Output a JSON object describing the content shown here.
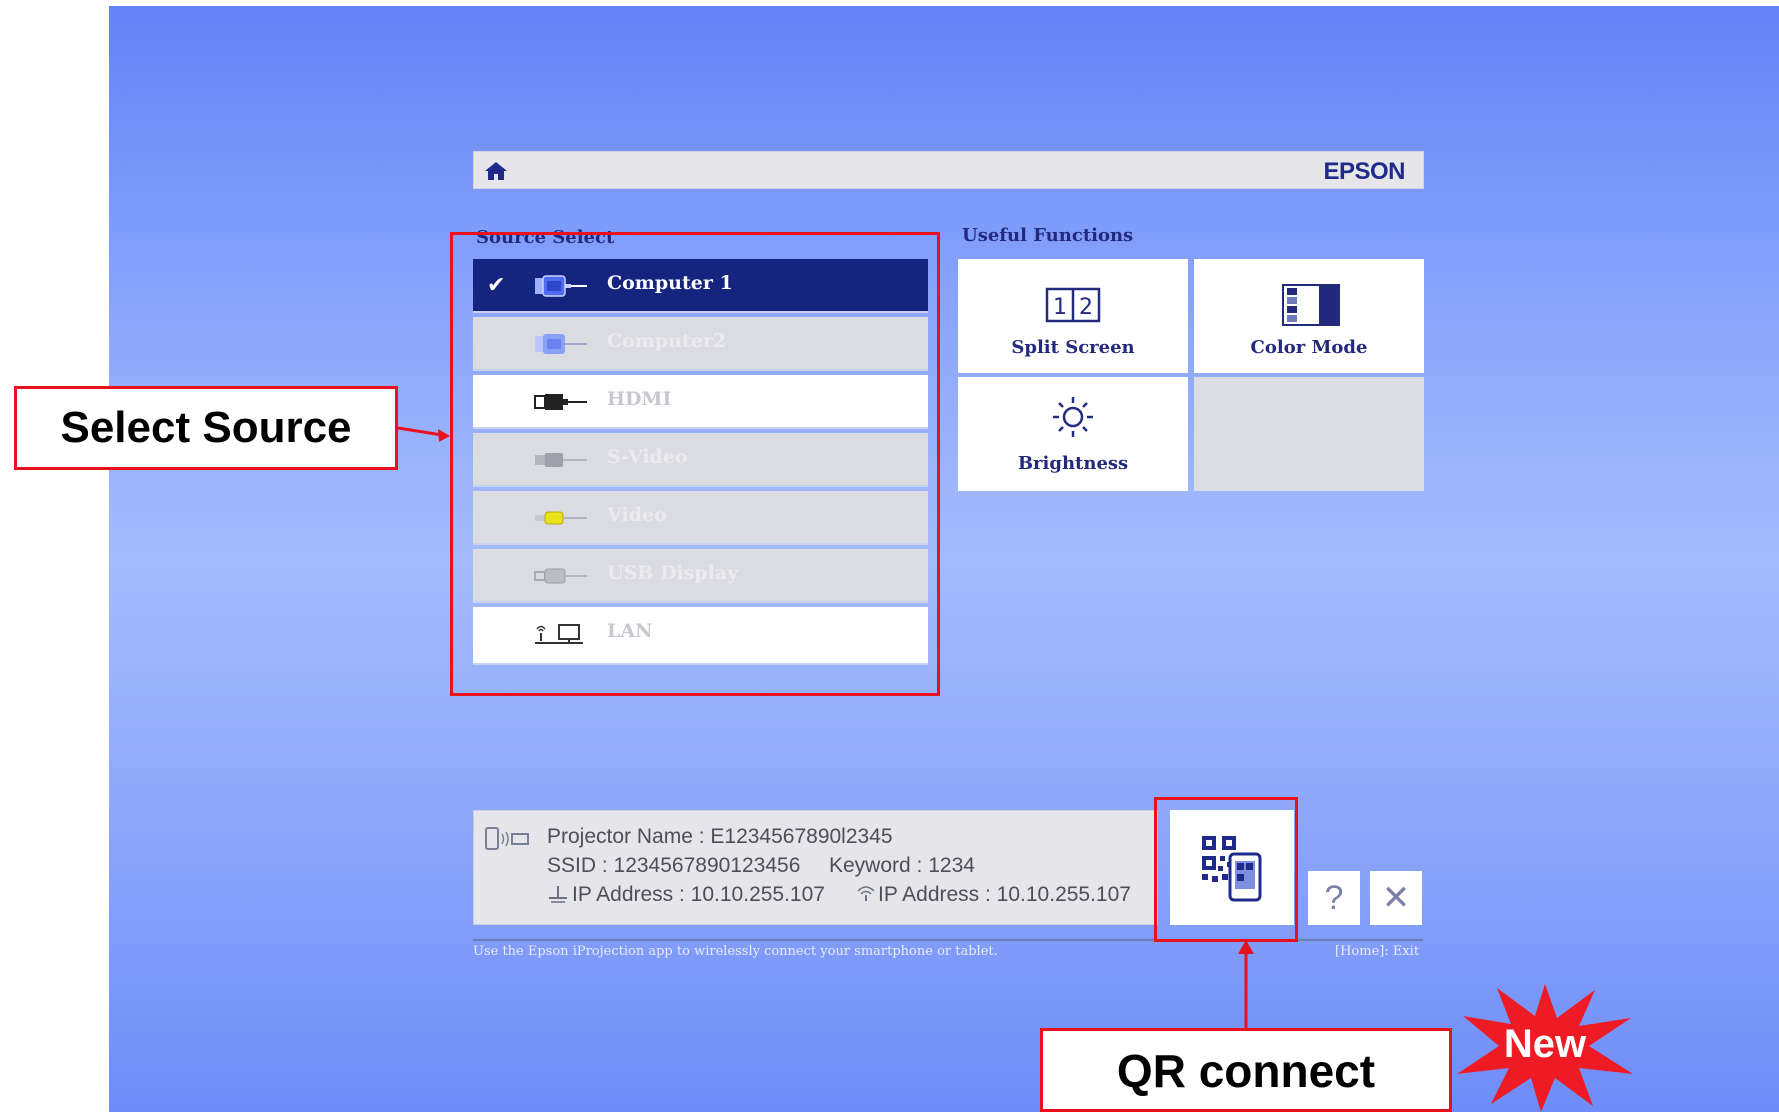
{
  "header": {
    "brand": "EPSON",
    "home_icon": "home-icon"
  },
  "source_select": {
    "title": "Source Select",
    "items": [
      {
        "label": "Computer 1",
        "icon": "vga-connector-icon",
        "selected": true,
        "state": "selected"
      },
      {
        "label": "Computer2",
        "icon": "vga-connector-icon",
        "selected": false,
        "state": "disabled"
      },
      {
        "label": "HDMI",
        "icon": "hdmi-connector-icon",
        "selected": false,
        "state": "available"
      },
      {
        "label": "S-Video",
        "icon": "svideo-connector-icon",
        "selected": false,
        "state": "disabled"
      },
      {
        "label": "Video",
        "icon": "rca-video-connector-icon",
        "selected": false,
        "state": "disabled"
      },
      {
        "label": "USB Display",
        "icon": "usb-connector-icon",
        "selected": false,
        "state": "disabled"
      },
      {
        "label": "LAN",
        "icon": "lan-network-icon",
        "selected": false,
        "state": "available"
      }
    ]
  },
  "useful_functions": {
    "title": "Useful Functions",
    "items": [
      {
        "label": "Split Screen",
        "icon": "split-screen-icon"
      },
      {
        "label": "Color Mode",
        "icon": "color-mode-icon"
      },
      {
        "label": "Brightness",
        "icon": "brightness-icon"
      }
    ]
  },
  "info": {
    "projector_name": "Projector Name : E1234567890l2345",
    "ssid": "SSID : 1234567890123456",
    "keyword": "Keyword : 1234",
    "ip_wired": "IP Address : 10.10.255.107",
    "ip_wireless": "IP Address : 10.10.255.107"
  },
  "buttons": {
    "help": "?",
    "close": "✕",
    "qr_icon": "qr-phone-icon"
  },
  "footer": {
    "hint": "Use the Epson iProjection app to wirelessly connect your smartphone or tablet.",
    "exit": "[Home]: Exit"
  },
  "annotations": {
    "select_source": "Select Source",
    "qr_connect": "QR connect",
    "new_badge": "New"
  },
  "colors": {
    "background_top": "#6383f7",
    "background_mid": "#a4bcfd",
    "selected_row": "#14247f",
    "annotation_red": "#e8111c",
    "title_navy": "#232a7e"
  }
}
